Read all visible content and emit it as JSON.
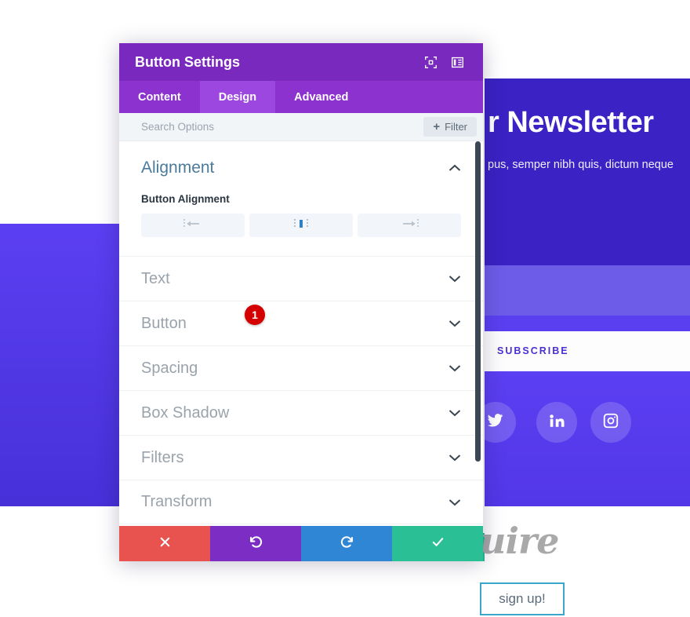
{
  "background": {
    "hero_title": "r Newsletter",
    "hero_subtitle": "pus, semper nibh quis, dictum neque",
    "subscribe_label": "SUBSCRIBE",
    "social": [
      {
        "name": "twitter-icon",
        "label": "Twitter"
      },
      {
        "name": "linkedin-icon",
        "label": "LinkedIn"
      },
      {
        "name": "instagram-icon",
        "label": "Instagram"
      }
    ],
    "logo_text": "uire",
    "signup_label": "sign up!",
    "colors": {
      "hero_band": "#3a22c4",
      "form_band": "#6c5ce8",
      "social_band": "#5b3ff2",
      "subscribe_text": "#4b2fd0",
      "signup_border": "#3aa6c9",
      "logo_accent": "#2bb79a"
    }
  },
  "modal": {
    "title": "Button Settings",
    "title_icons": [
      {
        "name": "expand-fullscreen-icon"
      },
      {
        "name": "panel-layout-icon"
      }
    ],
    "tabs": [
      {
        "label": "Content",
        "active": false
      },
      {
        "label": "Design",
        "active": true
      },
      {
        "label": "Advanced",
        "active": false
      }
    ],
    "search": {
      "placeholder": "Search Options",
      "filter_label": "Filter",
      "filter_plus": "+"
    },
    "alignment_section": {
      "title": "Alignment",
      "expanded": true,
      "field_label": "Button Alignment",
      "options": [
        {
          "name": "align-left",
          "selected": false
        },
        {
          "name": "align-center",
          "selected": true
        },
        {
          "name": "align-right",
          "selected": false
        }
      ],
      "badge": "1"
    },
    "accordion": [
      {
        "label": "Text"
      },
      {
        "label": "Button"
      },
      {
        "label": "Spacing"
      },
      {
        "label": "Box Shadow"
      },
      {
        "label": "Filters"
      },
      {
        "label": "Transform"
      }
    ],
    "actions": [
      {
        "name": "cancel-button",
        "icon": "close-icon",
        "color": "#e8534f"
      },
      {
        "name": "undo-button",
        "icon": "undo-icon",
        "color": "#7c2ec4"
      },
      {
        "name": "redo-button",
        "icon": "redo-icon",
        "color": "#2f86d4"
      },
      {
        "name": "save-button",
        "icon": "check-icon",
        "color": "#2bbf96"
      }
    ],
    "colors": {
      "titlebar": "#7a29bf",
      "tabbar": "#8c33cf",
      "tab_active": "#9c47df",
      "section_title": "#4a7b9c",
      "badge": "#d40000"
    }
  }
}
